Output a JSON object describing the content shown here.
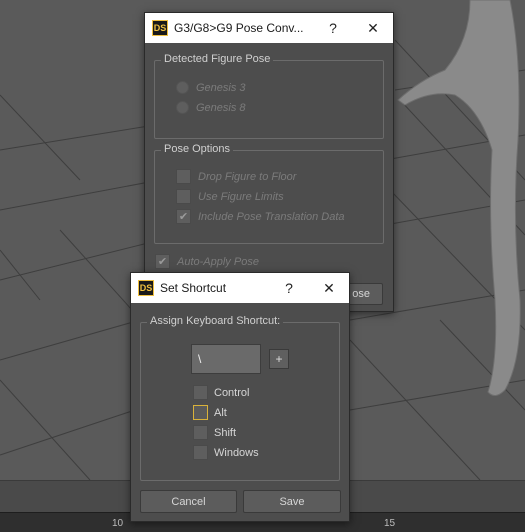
{
  "viewport": {
    "ruler_labels": [
      "10",
      "15"
    ]
  },
  "pose_dialog": {
    "title": "G3/G8>G9 Pose Conv...",
    "help_label": "?",
    "close_label": "✕",
    "logo": "DS",
    "detected_group": {
      "title": "Detected Figure Pose",
      "options": [
        "Genesis 3",
        "Genesis 8"
      ]
    },
    "options_group": {
      "title": "Pose Options",
      "items": [
        {
          "label": "Drop Figure to Floor",
          "checked": false
        },
        {
          "label": "Use Figure Limits",
          "checked": false
        },
        {
          "label": "Include Pose Translation Data",
          "checked": true
        }
      ]
    },
    "auto_apply": {
      "label": "Auto-Apply Pose",
      "checked": true
    },
    "partial_button": "ose"
  },
  "shortcut_dialog": {
    "title": "Set Shortcut",
    "help_label": "?",
    "close_label": "✕",
    "logo": "DS",
    "group_title": "Assign Keyboard Shortcut:",
    "key_value": "\\",
    "add_label": "+",
    "modifiers": [
      {
        "label": "Control",
        "checked": false
      },
      {
        "label": "Alt",
        "checked": false,
        "focused": true
      },
      {
        "label": "Shift",
        "checked": false
      },
      {
        "label": "Windows",
        "checked": false
      }
    ],
    "cancel_label": "Cancel",
    "save_label": "Save"
  }
}
